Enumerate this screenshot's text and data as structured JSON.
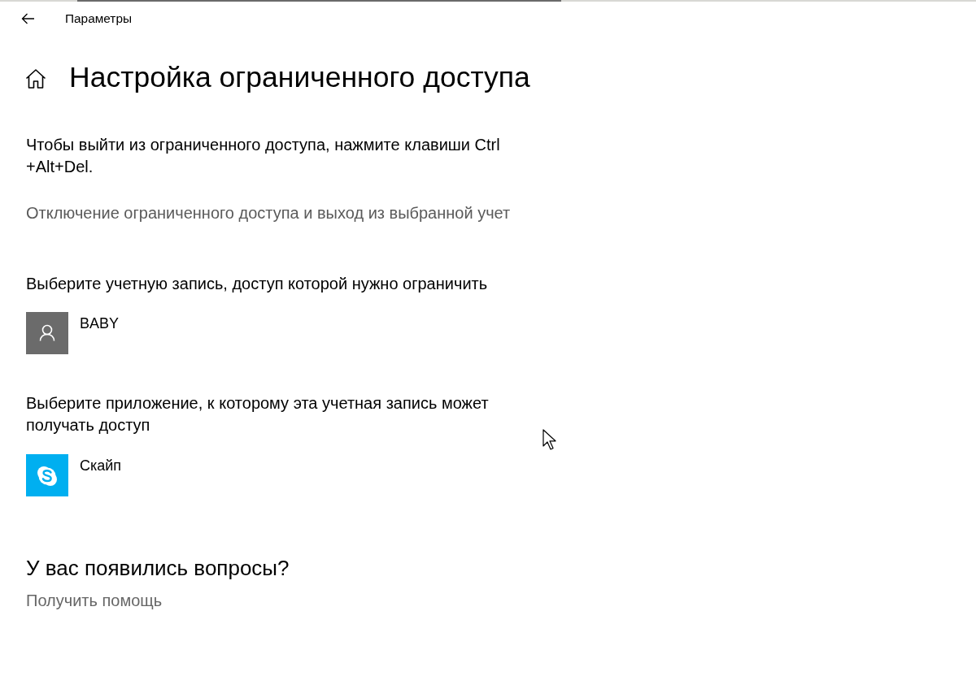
{
  "window": {
    "title": "Параметры"
  },
  "page": {
    "title": "Настройка ограниченного доступа"
  },
  "exit_hint": {
    "lines": [
      "Чтобы выйти из ограниченного доступа, нажмите клавиши Ctrl",
      "+Alt+Del."
    ]
  },
  "disable_link": {
    "label": "Отключение ограниченного доступа и выход из выбранной учет"
  },
  "account_section": {
    "heading_lines": [
      "Выберите учетную запись, доступ которой нужно ограничить"
    ],
    "account": {
      "name": "BABY"
    }
  },
  "app_section": {
    "heading_lines": [
      "Выберите приложение, к которому эта учетная запись может",
      "получать доступ"
    ],
    "app": {
      "name": "Скайп"
    }
  },
  "help": {
    "title": "У вас появились вопросы?",
    "link": "Получить помощь"
  }
}
